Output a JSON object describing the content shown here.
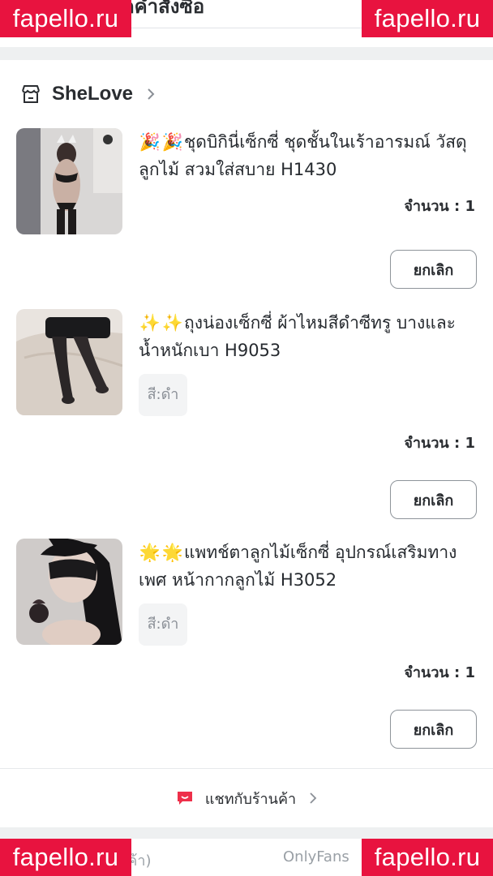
{
  "header": {
    "title_fragment": "ดคำสั่งซื้อ"
  },
  "shop": {
    "name": "SheLove",
    "icon": "store-icon"
  },
  "items": [
    {
      "emoji": [
        "🎉",
        "🎉"
      ],
      "title": "ชุดบิกินี่เซ็กซี่ ชุดชั้นในเร้าอารมณ์ วัสดุลูกไม้ สวมใส่สบาย H1430",
      "variant": "",
      "quantity": "จำนวน : 1",
      "cancel_label": "ยกเลิก"
    },
    {
      "emoji": [
        "✨",
        "✨"
      ],
      "title": "ถุงน่องเซ็กซี่ ผ้าไหมสีดำซีทรู บางและน้ำหนักเบา  H9053",
      "variant": "สี:ดำ",
      "quantity": "จำนวน : 1",
      "cancel_label": "ยกเลิก"
    },
    {
      "emoji": [
        "🌟",
        "🌟"
      ],
      "title": "แพทช์ตาลูกไม้เซ็กซี่ อุปกรณ์เสริมทางเพศ หน้ากากลูกไม้ H3052",
      "variant": "สี:ดำ",
      "quantity": "จำนวน : 1",
      "cancel_label": "ยกเลิก"
    }
  ],
  "chat": {
    "label": "แชทกับร้านค้า",
    "icon": "chat-bubble-icon"
  },
  "bottom": {
    "left_text": "สินค้า)",
    "right_text": "OnlyFans"
  },
  "watermark": {
    "text": "fapello.ru",
    "color": "#e8133f"
  }
}
